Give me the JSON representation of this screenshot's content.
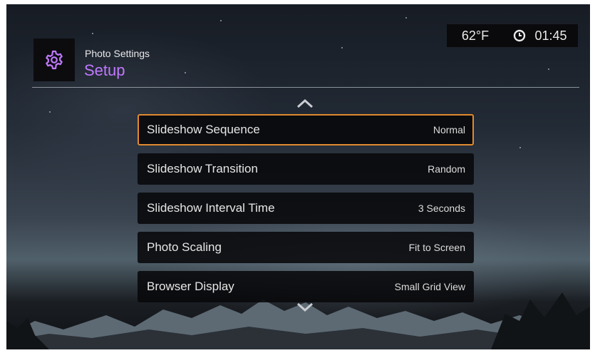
{
  "header": {
    "section": "Photo Settings",
    "title": "Setup",
    "icon": "gear-icon"
  },
  "status": {
    "temperature": "62°F",
    "time": "01:45",
    "clock_icon": "clock-icon"
  },
  "menu": {
    "items": [
      {
        "label": "Slideshow Sequence",
        "value": "Normal"
      },
      {
        "label": "Slideshow Transition",
        "value": "Random"
      },
      {
        "label": "Slideshow Interval Time",
        "value": "3 Seconds"
      },
      {
        "label": "Photo Scaling",
        "value": "Fit to Screen"
      },
      {
        "label": "Browser Display",
        "value": "Small Grid View"
      }
    ],
    "selected_index": 0
  },
  "colors": {
    "accent": "#c079ff",
    "focus_border": "#e08a2e"
  }
}
